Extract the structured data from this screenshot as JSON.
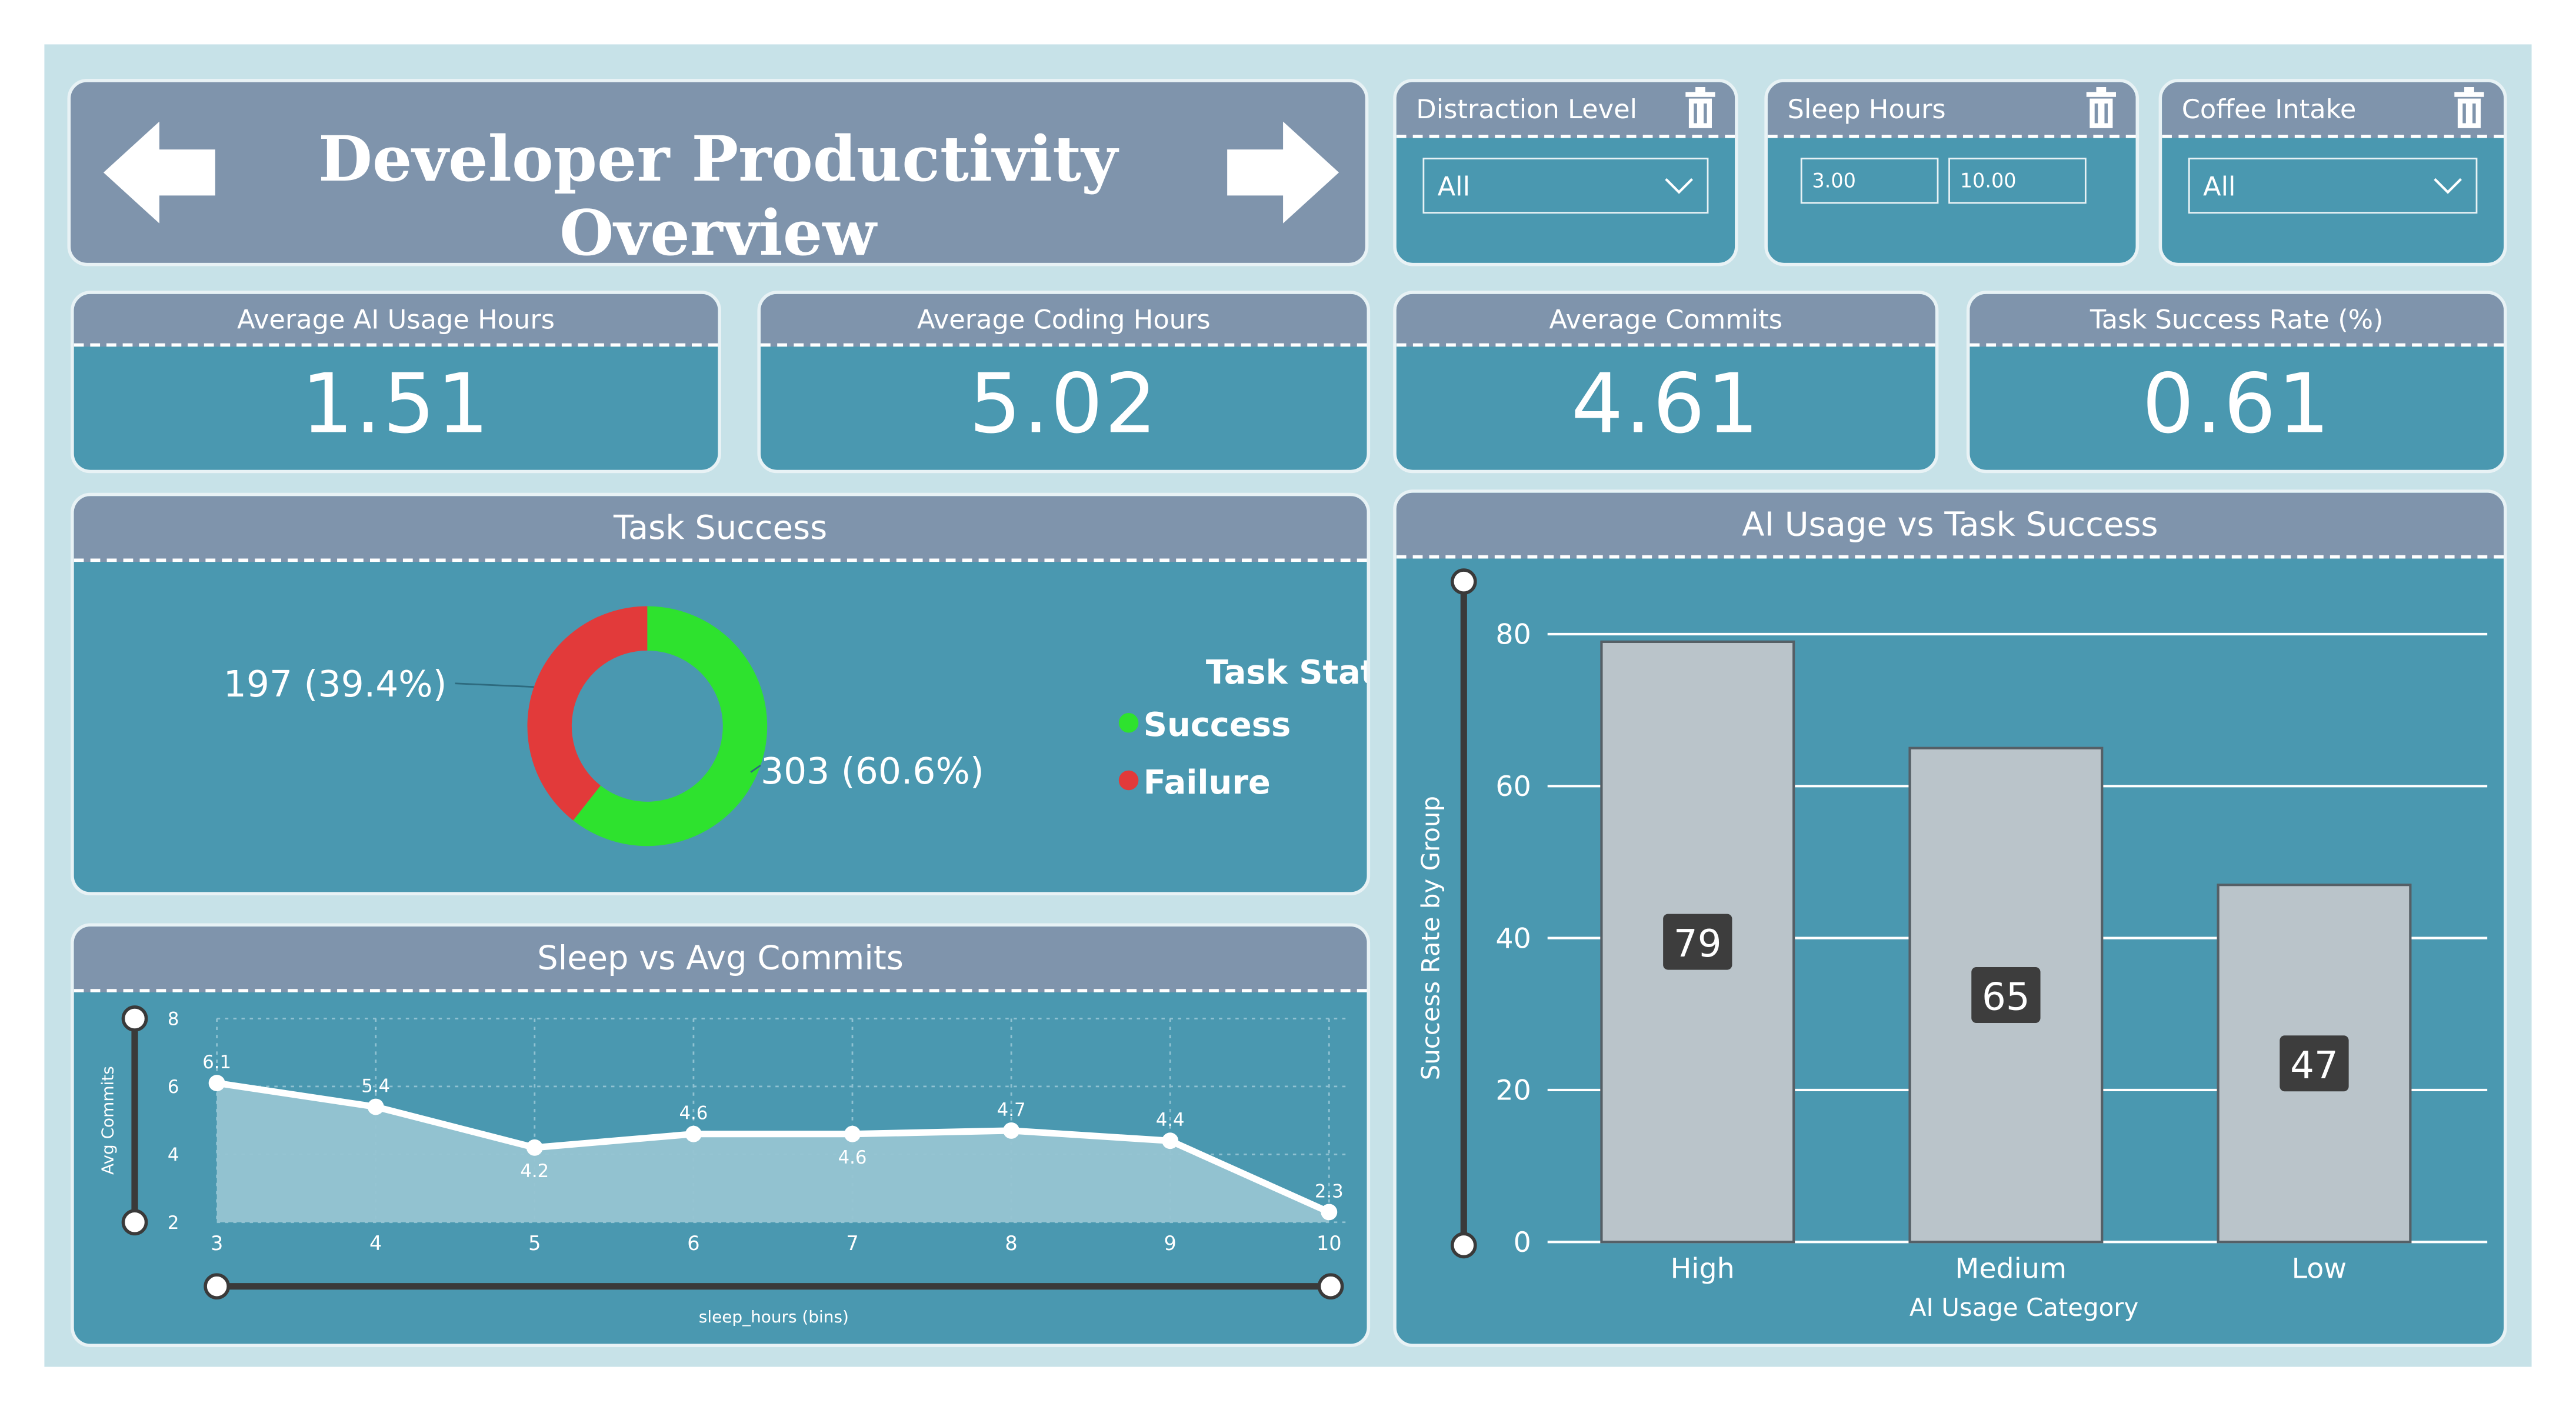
{
  "title": "Developer Productivity Overview",
  "filters": {
    "distraction": {
      "label": "Distraction Level",
      "value": "All"
    },
    "sleep": {
      "label": "Sleep Hours",
      "min": "3.00",
      "max": "10.00"
    },
    "coffee": {
      "label": "Coffee Intake",
      "value": "All"
    }
  },
  "kpis": [
    {
      "label": "Average AI Usage Hours",
      "value": "1.51"
    },
    {
      "label": "Average Coding Hours",
      "value": "5.02"
    },
    {
      "label": "Average Commits",
      "value": "4.61"
    },
    {
      "label": "Task Success Rate (%)",
      "value": "0.61"
    }
  ],
  "colors": {
    "success": "#2ee22e",
    "failure": "#e23a3a",
    "bar": "#bac4ca",
    "area": "#96c4d2"
  },
  "chart_data": [
    {
      "type": "pie",
      "title": "Task Success",
      "legend_title": "Task Status",
      "labels": [
        "Success",
        "Failure"
      ],
      "values": [
        303,
        197
      ],
      "data_labels": [
        "303 (60.6%)",
        "197 (39.4%)"
      ]
    },
    {
      "type": "area",
      "title": "Sleep vs Avg Commits",
      "xlabel": "sleep_hours (bins)",
      "ylabel": "Avg Commits",
      "x": [
        3,
        4,
        5,
        6,
        7,
        8,
        9,
        10
      ],
      "y": [
        6.1,
        5.4,
        4.2,
        4.6,
        4.6,
        4.7,
        4.4,
        2.3
      ],
      "point_labels": [
        "6.1",
        "5.4",
        "4.2",
        "4.6",
        "4.6",
        "4.7",
        "4.4",
        "2.3"
      ],
      "yticks": [
        "2",
        "4",
        "6",
        "8"
      ],
      "xticks": [
        "3",
        "4",
        "5",
        "6",
        "7",
        "8",
        "9",
        "10"
      ],
      "ylim": [
        2,
        8
      ],
      "xlim": [
        3,
        10
      ]
    },
    {
      "type": "bar",
      "title": "AI Usage vs Task Success",
      "xlabel": "AI Usage Category",
      "ylabel": "Success Rate by Group",
      "categories": [
        "High",
        "Medium",
        "Low"
      ],
      "values": [
        79,
        65,
        47
      ],
      "yticks": [
        "0",
        "20",
        "40",
        "60",
        "80"
      ],
      "ylim": [
        0,
        80
      ]
    }
  ]
}
